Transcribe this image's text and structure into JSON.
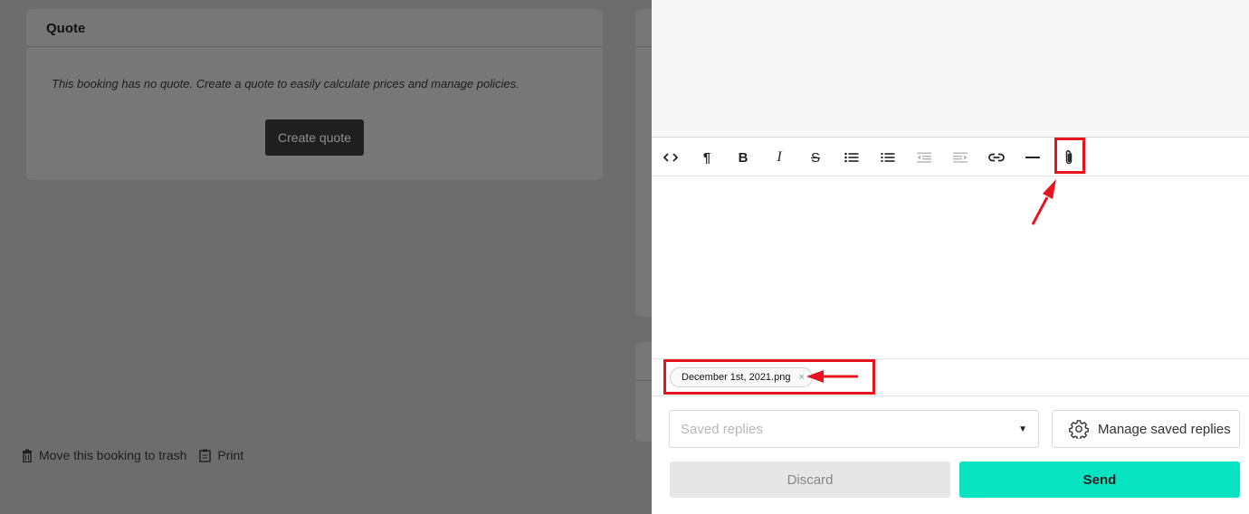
{
  "background": {
    "quote_card": {
      "title": "Quote",
      "message": "This booking has no quote. Create a quote to easily calculate prices and manage policies.",
      "create_button": "Create quote"
    },
    "footer_links": {
      "trash": "Move this booking to trash",
      "print": "Print"
    }
  },
  "composer": {
    "toolbar": [
      {
        "name": "code-view-icon",
        "glyph": "<>"
      },
      {
        "name": "paragraph-icon",
        "glyph": "¶"
      },
      {
        "name": "bold-icon",
        "glyph": "B"
      },
      {
        "name": "italic-icon",
        "glyph": "I"
      },
      {
        "name": "strikethrough-icon",
        "glyph": "S"
      },
      {
        "name": "bullet-list-icon",
        "glyph": ""
      },
      {
        "name": "numbered-list-icon",
        "glyph": ""
      },
      {
        "name": "outdent-icon",
        "glyph": ""
      },
      {
        "name": "indent-icon",
        "glyph": ""
      },
      {
        "name": "link-icon",
        "glyph": ""
      },
      {
        "name": "horizontal-rule-icon",
        "glyph": ""
      },
      {
        "name": "paperclip-icon",
        "glyph": ""
      }
    ],
    "attachment": {
      "filename": "December 1st, 2021.png",
      "remove_glyph": "×"
    },
    "saved_replies": {
      "placeholder": "Saved replies"
    },
    "manage_button": "Manage saved replies",
    "discard_button": "Discard",
    "send_button": "Send"
  },
  "colors": {
    "send": "#08e3c1",
    "highlight": "#e6151d",
    "overlay": "#6d6d6d"
  }
}
